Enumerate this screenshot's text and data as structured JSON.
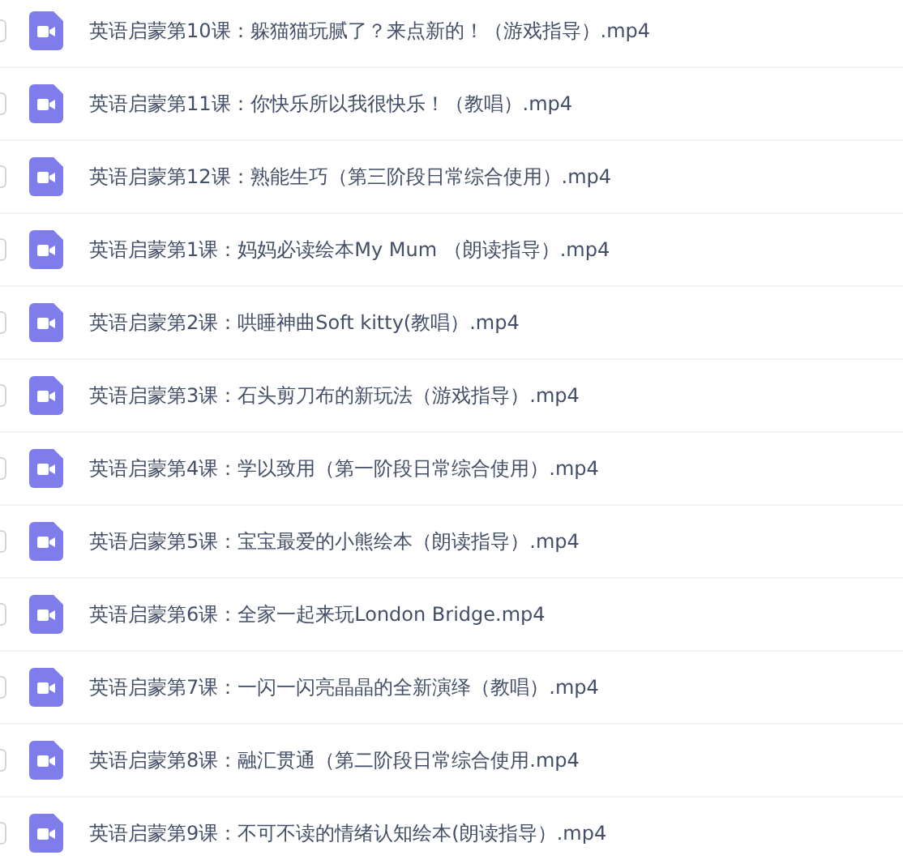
{
  "files": [
    {
      "name": "英语启蒙第10课：躲猫猫玩腻了？来点新的！（游戏指导）.mp4",
      "checked": false
    },
    {
      "name": "英语启蒙第11课：你快乐所以我很快乐！（教唱）.mp4",
      "checked": false
    },
    {
      "name": "英语启蒙第12课：熟能生巧（第三阶段日常综合使用）.mp4",
      "checked": false
    },
    {
      "name": "英语启蒙第1课：妈妈必读绘本My Mum （朗读指导）.mp4",
      "checked": false
    },
    {
      "name": "英语启蒙第2课：哄睡神曲Soft kitty(教唱）.mp4",
      "checked": false
    },
    {
      "name": "英语启蒙第3课：石头剪刀布的新玩法（游戏指导）.mp4",
      "checked": false
    },
    {
      "name": "英语启蒙第4课：学以致用（第一阶段日常综合使用）.mp4",
      "checked": false
    },
    {
      "name": "英语启蒙第5课：宝宝最爱的小熊绘本（朗读指导）.mp4",
      "checked": false
    },
    {
      "name": "英语启蒙第6课：全家一起来玩London Bridge.mp4",
      "checked": false
    },
    {
      "name": "英语启蒙第7课：一闪一闪亮晶晶的全新演绎（教唱）.mp4",
      "checked": false
    },
    {
      "name": "英语启蒙第8课：融汇贯通（第二阶段日常综合使用.mp4",
      "checked": false
    },
    {
      "name": "英语启蒙第9课：不可不读的情绪认知绘本(朗读指导）.mp4",
      "checked": false
    }
  ]
}
